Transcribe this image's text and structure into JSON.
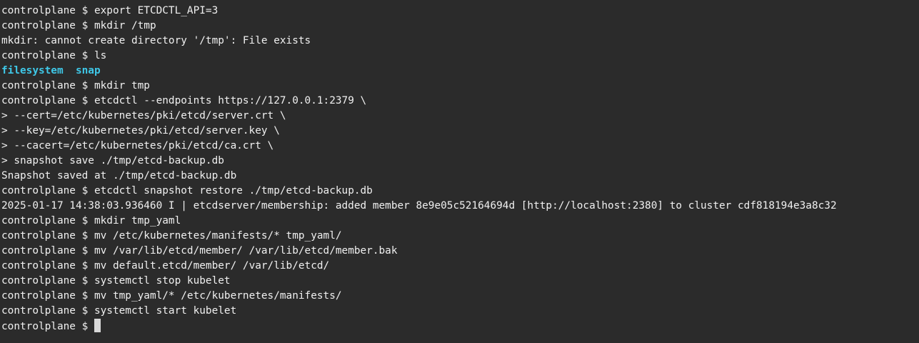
{
  "terminal": {
    "prompt": "controlplane $ ",
    "lines": [
      {
        "kind": "command",
        "text": "export ETCDCTL_API=3"
      },
      {
        "kind": "command",
        "text": "mkdir /tmp"
      },
      {
        "kind": "output",
        "text": "mkdir: cannot create directory '/tmp': File exists"
      },
      {
        "kind": "command",
        "text": "ls"
      },
      {
        "kind": "ls",
        "items": [
          "filesystem",
          "snap"
        ]
      },
      {
        "kind": "command",
        "text": "mkdir tmp"
      },
      {
        "kind": "command",
        "text": "etcdctl --endpoints https://127.0.0.1:2379 \\"
      },
      {
        "kind": "output",
        "text": "> --cert=/etc/kubernetes/pki/etcd/server.crt \\"
      },
      {
        "kind": "output",
        "text": "> --key=/etc/kubernetes/pki/etcd/server.key \\"
      },
      {
        "kind": "output",
        "text": "> --cacert=/etc/kubernetes/pki/etcd/ca.crt \\"
      },
      {
        "kind": "output",
        "text": "> snapshot save ./tmp/etcd-backup.db"
      },
      {
        "kind": "output",
        "text": "Snapshot saved at ./tmp/etcd-backup.db"
      },
      {
        "kind": "command",
        "text": "etcdctl snapshot restore ./tmp/etcd-backup.db"
      },
      {
        "kind": "output",
        "text": "2025-01-17 14:38:03.936460 I | etcdserver/membership: added member 8e9e05c52164694d [http://localhost:2380] to cluster cdf818194e3a8c32"
      },
      {
        "kind": "command",
        "text": "mkdir tmp_yaml"
      },
      {
        "kind": "command",
        "text": "mv /etc/kubernetes/manifests/* tmp_yaml/"
      },
      {
        "kind": "command",
        "text": "mv /var/lib/etcd/member/ /var/lib/etcd/member.bak"
      },
      {
        "kind": "command",
        "text": "mv default.etcd/member/ /var/lib/etcd/"
      },
      {
        "kind": "command",
        "text": "systemctl stop kubelet"
      },
      {
        "kind": "command",
        "text": "mv tmp_yaml/* /etc/kubernetes/manifests/"
      },
      {
        "kind": "command",
        "text": "systemctl start kubelet"
      },
      {
        "kind": "current",
        "text": ""
      }
    ],
    "colors": {
      "background": "#2b2b2b",
      "foreground": "#f0f0f0",
      "directory": "#3fc8e8",
      "cursor": "#d8d8d8"
    }
  }
}
